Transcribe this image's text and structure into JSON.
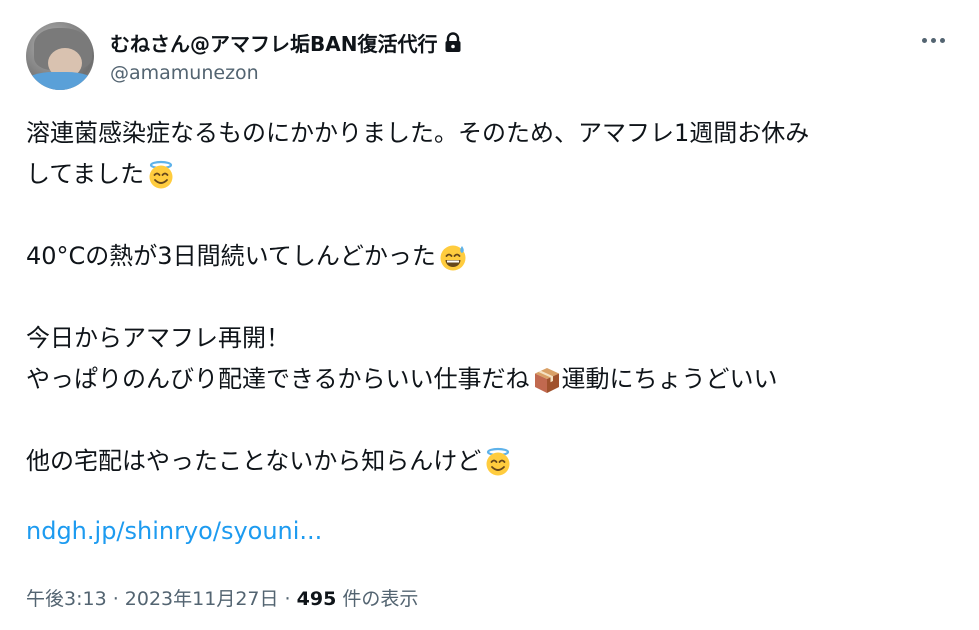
{
  "author": {
    "display_name": "むねさん@アマフレ垢BAN復活代行",
    "handle": "@amamunezon"
  },
  "icons": {
    "lock": "lock-icon",
    "more": "more-icon",
    "halo_face": "smiling-face-with-halo-emoji",
    "sweat_face": "grinning-face-with-sweat-emoji",
    "package": "package-emoji"
  },
  "tweet": {
    "line1": "溶連菌感染症なるものにかかりました。そのため、アマフレ1週間お休み",
    "line2": "してました",
    "line3": "40°Cの熱が3日間続いてしんどかった",
    "line4": "今日からアマフレ再開！",
    "line5a": "やっぱりのんびり配達できるからいい仕事だね",
    "line5b": "運動にちょうどいい",
    "line6": "他の宅配はやったことないから知らんけど",
    "link": "ndgh.jp/shinryo/syouni..."
  },
  "meta": {
    "time": "午後3:13",
    "sep1": " · ",
    "date": "2023年11月27日",
    "sep2": " · ",
    "views_count": "495",
    "views_label": " 件の表示"
  },
  "colors": {
    "text": "#0f1419",
    "secondary": "#536471",
    "link": "#1d9bf0"
  }
}
